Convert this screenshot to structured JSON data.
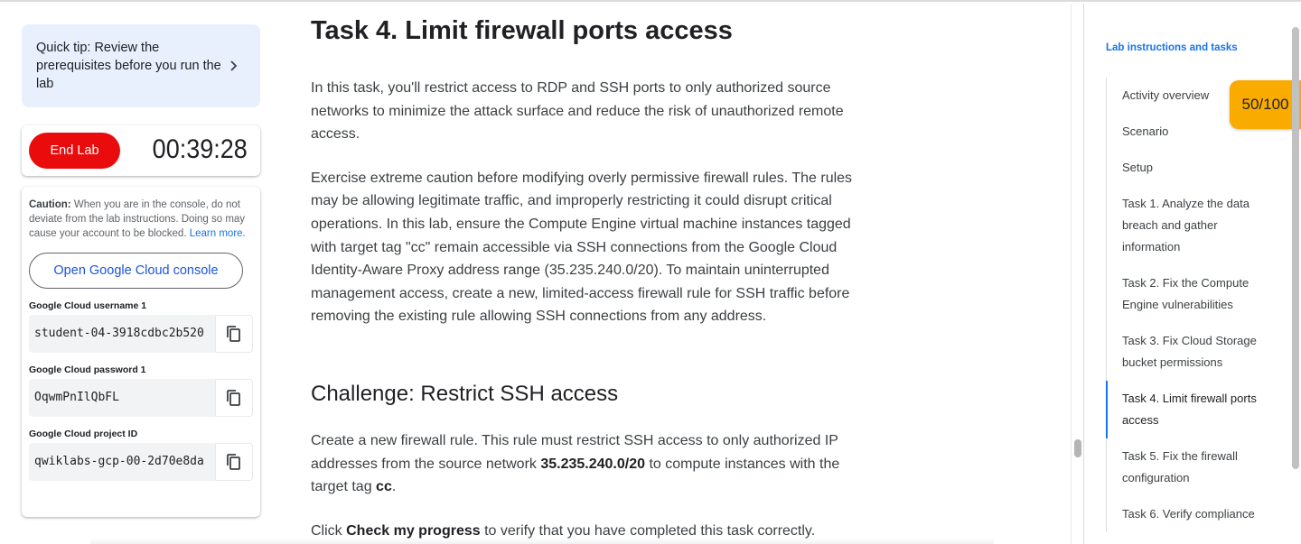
{
  "left_panel": {
    "quick_tip": "Quick tip: Review the prerequisites before you run the lab",
    "end_lab_label": "End Lab",
    "timer": "00:39:28",
    "caution_bold": "Caution:",
    "caution_text": " When you are in the console, do not deviate from the lab instructions. Doing so may cause your account to be blocked.",
    "learn_more": "Learn more.",
    "open_console_label": "Open Google Cloud console",
    "fields": [
      {
        "label": "Google Cloud username 1",
        "value": "student-04-3918cdbc2b520"
      },
      {
        "label": "Google Cloud password 1",
        "value": "OqwmPnIlQbFL"
      },
      {
        "label": "Google Cloud project ID",
        "value": "qwiklabs-gcp-00-2d70e8da"
      }
    ]
  },
  "main": {
    "title": "Task 4. Limit firewall ports access",
    "para1": "In this task, you'll restrict access to RDP and SSH ports to only authorized source networks to minimize the attack surface and reduce the risk of unauthorized remote access.",
    "para2": "Exercise extreme caution before modifying overly permissive firewall rules. The rules may be allowing legitimate traffic, and improperly restricting it could disrupt critical operations. In this lab, ensure the Compute Engine virtual machine instances tagged with target tag \"cc\" remain accessible via SSH connections from the Google Cloud Identity-Aware Proxy address range (35.235.240.0/20). To maintain uninterrupted management access, create a new, limited-access firewall rule for SSH traffic before removing the existing rule allowing SSH connections from any address.",
    "challenge_heading": "Challenge: Restrict SSH access",
    "para3_a": "Create a new firewall rule. This rule must restrict SSH access to only authorized IP addresses from the source network ",
    "para3_b": "35.235.240.0/20",
    "para3_c": " to compute instances with the target tag ",
    "para3_d": "cc",
    "para3_e": ".",
    "para4_a": "Click",
    "para4_b": "Check my progress",
    "para4_c": "to verify that you have completed this task correctly."
  },
  "toc": {
    "title": "Lab instructions and tasks",
    "items": [
      "Activity overview",
      "Scenario",
      "Setup",
      "Task 1. Analyze the data breach and gather information",
      "Task 2. Fix the Compute Engine vulnerabilities",
      "Task 3. Fix Cloud Storage bucket permissions",
      "Task 4. Limit firewall ports access",
      "Task 5. Fix the firewall configuration",
      "Task 6. Verify compliance"
    ],
    "active_index": 6
  },
  "score": "50/100",
  "colors": {
    "end_lab": "#ea0c0c",
    "score_badge": "#f9ab00",
    "link": "#1a73e8",
    "tip_bg": "#e8f0fe"
  }
}
